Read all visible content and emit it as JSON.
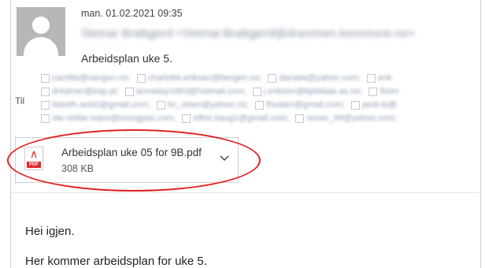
{
  "message": {
    "date": "man. 01.02.2021 09:35",
    "sender": "Steinar Brattgjerd <Steinar.Brattgjerd@drammen.kommune.no>",
    "subject": "Arbeidsplan uke 5.",
    "to_label": "Til",
    "recipients": [
      [
        "camilla@vangen.no;",
        "charlotte.eriksen@bergen.no;",
        "danaila@yahoo.com;",
        "erik"
      ],
      [
        "dreamer@esp.pl;",
        "annaday1963@hotmail.com;",
        "j.eriksen@kjeldaas.as.no;",
        "thom"
      ],
      [
        "lisbeth.ackl2@gmail.com;",
        "lin_olsen@yahoo.no;",
        "fhvalen@gmail.com;",
        "pedi-lo@"
      ],
      [
        "ole-reidar.waxx@mongpas.com;",
        "elfrei.haug1@gmail.com;",
        "renan_99@yahoo.com;"
      ]
    ]
  },
  "attachment": {
    "file_name": "Arbeidsplan uke 05 for 9B.pdf",
    "file_size": "308 KB",
    "icon": "pdf-icon",
    "icon_tag": "PDF",
    "icon_color": "#e0262a"
  },
  "annotation": {
    "highlight_color": "#e02020"
  },
  "body": {
    "line1": "Hei igjen.",
    "line2": "Her kommer arbeidsplan for uke 5."
  }
}
